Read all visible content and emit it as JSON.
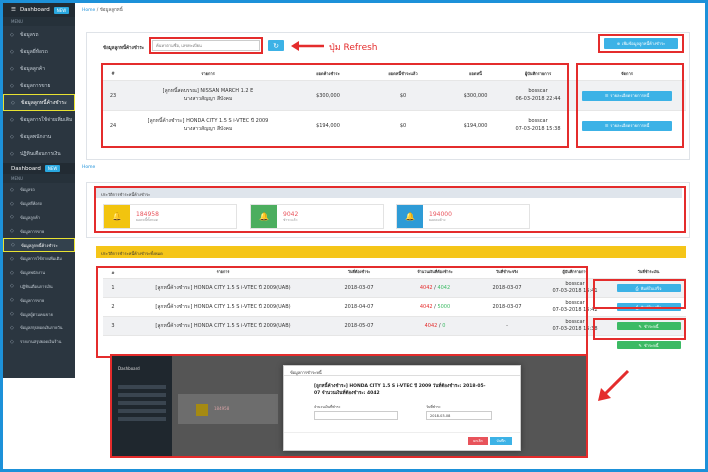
{
  "brand": {
    "dashboard": "Dashboard",
    "badge": "NEW"
  },
  "sidebar_top": {
    "items": [
      {
        "label": "ข้อมูลรถ",
        "icon": "tag-icon"
      },
      {
        "label": "ข้อมูลยี่ห้อรถ",
        "icon": "tag-icon"
      },
      {
        "label": "ข้อมูลลูกค้า",
        "icon": "tag-icon"
      },
      {
        "label": "ข้อมูลการขาย",
        "icon": "tag-icon"
      },
      {
        "label": "ข้อมูลลูกหนี้ค้างชำระ",
        "icon": "tag-icon"
      },
      {
        "label": "ข้อมูลการใช้จ่ายเพิ่มเติม",
        "icon": "tag-icon"
      },
      {
        "label": "ข้อมูลพนักงาน",
        "icon": "tag-icon"
      },
      {
        "label": "ปฏิทินเตือนการเงิน",
        "icon": "tag-icon"
      }
    ]
  },
  "sidebar_bottom": {
    "items": [
      {
        "label": "ข้อมูลรถ"
      },
      {
        "label": "ข้อมูลยี่ห้อรถ"
      },
      {
        "label": "ข้อมูลลูกค้า"
      },
      {
        "label": "ข้อมูลการขาย"
      },
      {
        "label": "ข้อมูลลูกหนี้ค้างชำระ"
      },
      {
        "label": "ข้อมูลการใช้จ่ายเพิ่มเติม"
      },
      {
        "label": "ข้อมูลพนักงาน"
      },
      {
        "label": "ปฏิทินเตือนการเงิน"
      },
      {
        "label": "ข้อมูลการขาย"
      },
      {
        "label": "ข้อมูลผู้ตามคนขาย"
      },
      {
        "label": "ข้อมูลสรุปยอดเงินรายวัน"
      },
      {
        "label": "รายงานสรุปยอดเงินร้าน"
      }
    ]
  },
  "top": {
    "breadcrumb_home": "Home",
    "breadcrumb_page": "ข้อมูลลูกหนี้",
    "section_title": "ข้อมูลลูกหนี้ค้างชำระ",
    "search_placeholder": "ค้นหาตามชื่อ, เลขทะเบียน",
    "refresh_annotation": "ปุ่ม  Refresh",
    "add_button": "เพิ่มข้อมูลลูกหนี้ค้างชำระ",
    "columns": [
      "#",
      "รายการ",
      "ยอดค้างชำระ",
      "ยอดหนี้ชำระแล้ว",
      "ยอดหนี้",
      "ผู้บันทึกรายการ",
      "จัดการ"
    ],
    "rows": [
      {
        "no": "23",
        "item": "[ลูกหนี้สดบรรณ] NISSAN MARCH 1.2 E",
        "sub": "นางสาวสัญญา สีบังคม",
        "amount": "$300,000",
        "paid": "$0",
        "debt": "$300,000",
        "by": "bosscar",
        "date": "06-03-2018 22:44",
        "action": "รายละเอียดรายการหนี้"
      },
      {
        "no": "24",
        "item": "[ลูกหนี้ค้างชำระ] HONDA CITY 1.5 S i-VTEC ปี 2009",
        "sub": "นางสาวสัญญา สีบังคม",
        "amount": "$194,000",
        "paid": "$0",
        "debt": "$194,000",
        "by": "bosscar",
        "date": "07-03-2018 15:38",
        "action": "รายละเอียดรายการหนี้"
      }
    ]
  },
  "bottom": {
    "breadcrumb_home": "Home",
    "summary_title": "ประวัติการชำระหนี้ค้างชำระ",
    "stats": [
      {
        "value": "184958",
        "label": "ยอดหนี้ทั้งหมด",
        "color": "#f2c40f"
      },
      {
        "value": "9042",
        "label": "ชำระแล้ว",
        "color": "#4cae5f"
      },
      {
        "value": "194000",
        "label": "ยอดคงค้าง",
        "color": "#2e9bd6"
      }
    ],
    "history_title": "ประวัติการชำระหนี้ค้างชำระทั้งหมด",
    "columns": [
      "#",
      "รายการ",
      "วันที่ต้องชำระ",
      "จำนวนเงินที่ต้องชำระ",
      "วันที่ชำระจริง",
      "ผู้บันทึกรายการ",
      "วันที่ชำระเงิน"
    ],
    "rows": [
      {
        "no": "1",
        "item": "[ลูกหนี้ค้างชำระ] HONDA CITY 1.5 S i-VTEC ปี 2009(UAB)",
        "due": "2018-03-07",
        "amt_a": "4042",
        "amt_b": "4042",
        "paid_date": "2018-03-07",
        "by": "bosscar",
        "date": "07-03-2018 15:41",
        "action": "พิมพ์ใบเสร็จ",
        "kind": "blue"
      },
      {
        "no": "2",
        "item": "[ลูกหนี้ค้างชำระ] HONDA CITY 1.5 S i-VTEC ปี 2009(UAB)",
        "due": "2018-04-07",
        "amt_a": "4042",
        "amt_b": "5000",
        "paid_date": "2018-03-07",
        "by": "bosscar",
        "date": "07-03-2018 15:42",
        "action": "พิมพ์ใบเสร็จ",
        "kind": "blue"
      },
      {
        "no": "3",
        "item": "[ลูกหนี้ค้างชำระ] HONDA CITY 1.5 S i-VTEC ปี 2009(UAB)",
        "due": "2018-05-07",
        "amt_a": "4042",
        "amt_b": "0",
        "paid_date": "-",
        "by": "bosscar",
        "date": "07-03-2018 15:38",
        "action": "ชำระหนี้",
        "kind": "green"
      },
      {
        "no": "",
        "item": "",
        "due": "",
        "amt_a": "",
        "amt_b": "",
        "paid_date": "",
        "by": "",
        "date": "",
        "action": "ชำระหนี้",
        "kind": "green"
      }
    ]
  },
  "modal": {
    "title": "ข้อมูลการชำระหนี้",
    "heading": "[ลูกหนี้ค้างชำระ] HONDA CITY 1.5 S i-VTEC ปี 2009   วันที่ต้องชำระ: 2018-05-07   จำนวนเงินที่ต้องชำระ: 4042",
    "label_amount": "จำนวนเงินที่ชำระ",
    "label_date": "วันที่ชำระ",
    "date_value": "2018-03-08",
    "cancel": "ยกเลิก",
    "save": "บันทึก"
  },
  "mini": {
    "dashboard": "Dashboard",
    "stat_value": "184958"
  },
  "colors": {
    "accent": "#1d91d9",
    "sidebar": "#2b3640",
    "highlight": "#e8e232",
    "annotation": "#e42c2c"
  }
}
